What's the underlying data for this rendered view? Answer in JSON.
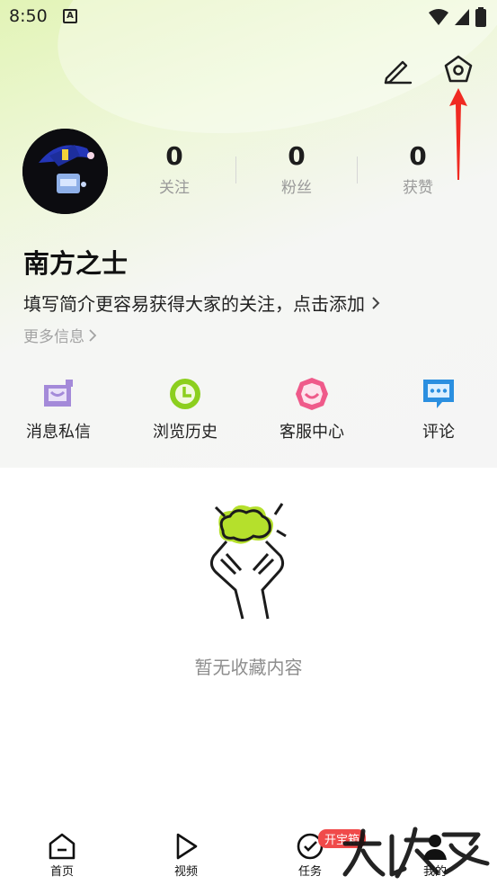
{
  "status_bar": {
    "time": "8:50",
    "notification_letter": "A"
  },
  "header": {
    "edit_icon": "edit-icon",
    "settings_icon": "settings-icon"
  },
  "profile": {
    "username": "南方之士",
    "bio": "填写简介更容易获得大家的关注，点击添加",
    "more_info": "更多信息",
    "stats": [
      {
        "value": "0",
        "label": "关注"
      },
      {
        "value": "0",
        "label": "粉丝"
      },
      {
        "value": "0",
        "label": "获赞"
      }
    ]
  },
  "quick_actions": [
    {
      "label": "消息私信",
      "icon": "message-icon",
      "color": "#a48ad9"
    },
    {
      "label": "浏览历史",
      "icon": "history-clock-icon",
      "color": "#8ccf1e"
    },
    {
      "label": "客服中心",
      "icon": "service-face-icon",
      "color": "#ef5a8a"
    },
    {
      "label": "评论",
      "icon": "comment-icon",
      "color": "#2b8fe0"
    }
  ],
  "empty_state": {
    "text": "暂无收藏内容"
  },
  "tabbar": {
    "tabs": [
      {
        "label": "首页",
        "icon": "home-icon"
      },
      {
        "label": "视频",
        "icon": "play-icon"
      },
      {
        "label": "任务",
        "icon": "task-check-icon"
      },
      {
        "label": "我的",
        "icon": "profile-icon"
      }
    ],
    "badge": "开宝箱"
  },
  "colors": {
    "accent_green": "#b5e02c",
    "arrow_red": "#f02a22"
  }
}
